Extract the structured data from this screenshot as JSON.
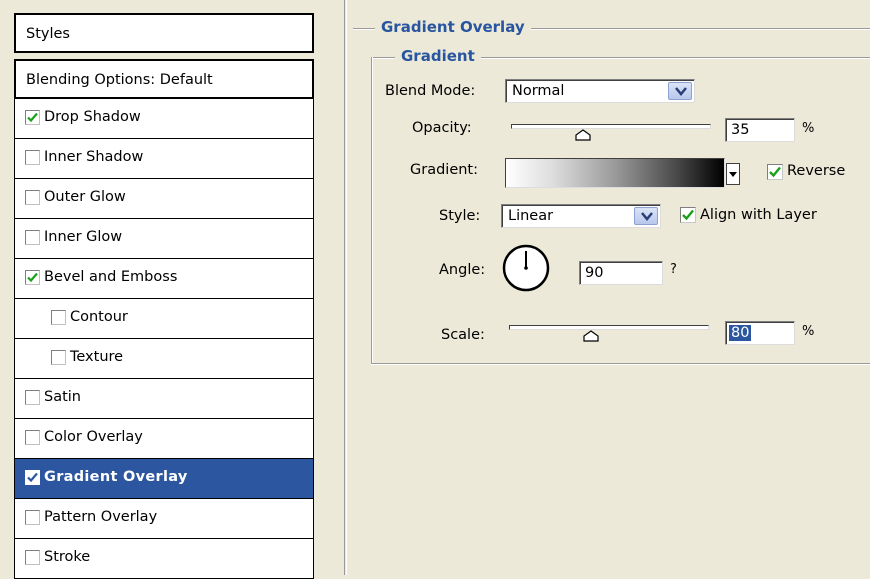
{
  "styles_list": {
    "header": "Styles",
    "blending": "Blending Options: Default",
    "items": [
      {
        "label": "Drop Shadow",
        "checked": true
      },
      {
        "label": "Inner Shadow",
        "checked": false
      },
      {
        "label": "Outer Glow",
        "checked": false
      },
      {
        "label": "Inner Glow",
        "checked": false
      },
      {
        "label": "Bevel and Emboss",
        "checked": true
      },
      {
        "label": "Contour",
        "checked": false
      },
      {
        "label": "Texture",
        "checked": false
      },
      {
        "label": "Satin",
        "checked": false
      },
      {
        "label": "Color Overlay",
        "checked": false
      },
      {
        "label": "Gradient Overlay",
        "checked": true,
        "selected": true
      },
      {
        "label": "Pattern Overlay",
        "checked": false
      },
      {
        "label": "Stroke",
        "checked": false
      }
    ]
  },
  "panel": {
    "title": "Gradient Overlay",
    "group_title": "Gradient",
    "blend_mode": {
      "label": "Blend Mode:",
      "value": "Normal"
    },
    "opacity": {
      "label": "Opacity:",
      "value": "35",
      "unit": "%",
      "level": 0.35
    },
    "gradient": {
      "label": "Gradient:",
      "reverse_label": "Reverse",
      "reverse_checked": true
    },
    "style": {
      "label": "Style:",
      "value": "Linear",
      "align_label": "Align with Layer",
      "align_checked": true
    },
    "angle": {
      "label": "Angle:",
      "value": "90",
      "unit": "?"
    },
    "scale": {
      "label": "Scale:",
      "value": "80",
      "unit": "%",
      "level": 0.4
    }
  },
  "colors": {
    "accent": "#2855a0",
    "selection": "#2c57a0",
    "checkmark": "#1aa01a",
    "background": "#ece9d8"
  },
  "icons": [
    "checkbox-checked-icon",
    "checkbox-empty-icon",
    "chevron-down-icon",
    "slider-thumb-icon",
    "angle-dial-icon",
    "dropdown-arrow-icon"
  ]
}
